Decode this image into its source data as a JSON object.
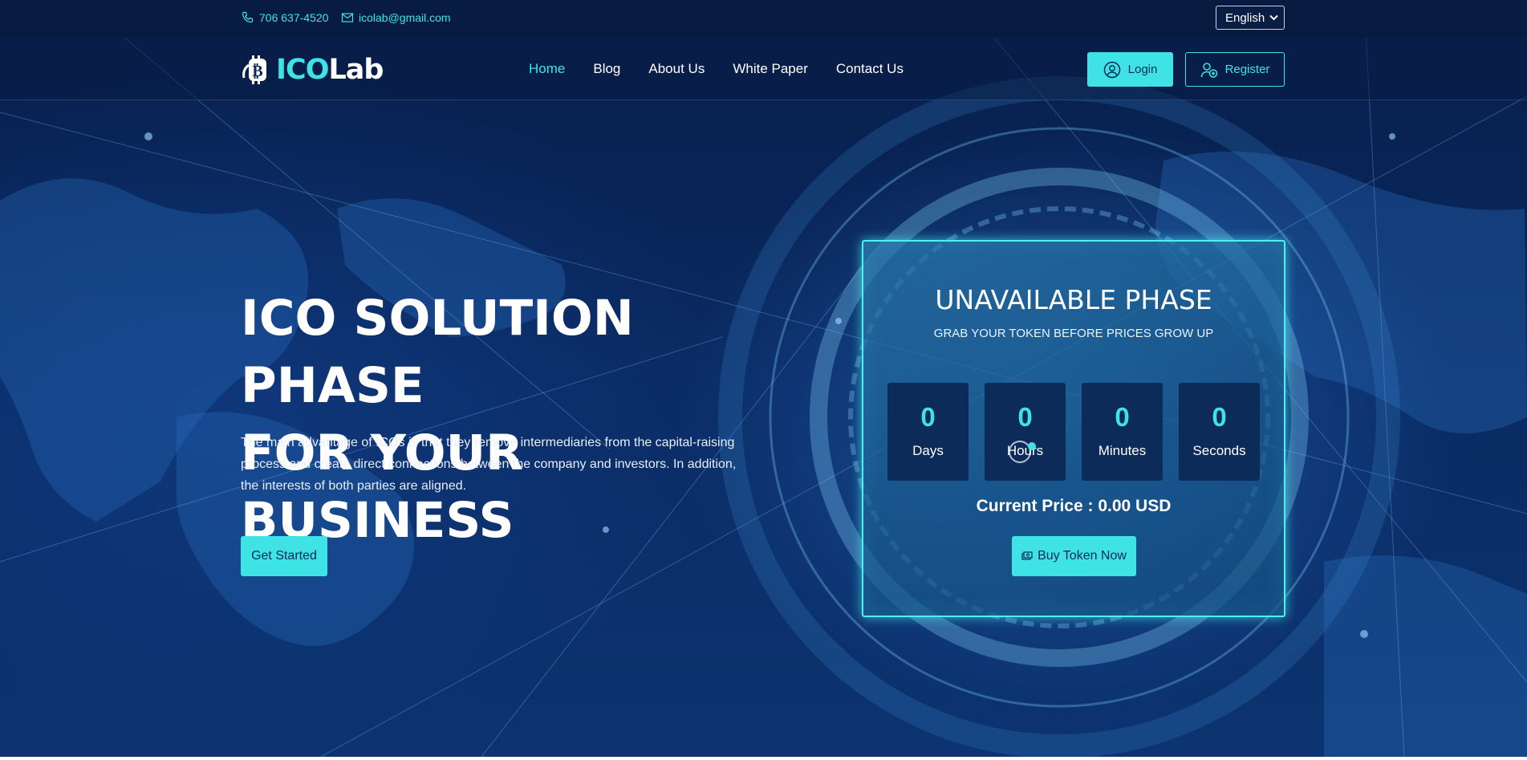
{
  "topbar": {
    "phone": "706 637-4520",
    "email": "icolab@gmail.com",
    "language": "English"
  },
  "header": {
    "logo_text": "ICOLab",
    "nav": [
      "Home",
      "Blog",
      "About Us",
      "White Paper",
      "Contact Us"
    ],
    "active_nav": "Home",
    "login_label": "Login",
    "register_label": "Register"
  },
  "hero": {
    "title_line1": "ICO SOLUTION PHASE",
    "title_line2": "FOR YOUR BUSINESS",
    "description": "The main advantage of ICOs is that they remove intermediaries from the capital-raising process and create direct connections between the company and investors. In addition, the interests of both parties are aligned.",
    "cta_label": "Get Started"
  },
  "countdown": {
    "title": "UNAVAILABLE PHASE",
    "subtitle": "GRAB YOUR TOKEN BEFORE PRICES GROW UP",
    "units": [
      {
        "value": "0",
        "label": "Days"
      },
      {
        "value": "0",
        "label": "Hours"
      },
      {
        "value": "0",
        "label": "Minutes"
      },
      {
        "value": "0",
        "label": "Seconds"
      }
    ],
    "price_text": "Current Price : 0.00 USD",
    "buy_label": "Buy Token Now"
  },
  "colors": {
    "accent": "#3fe3e6",
    "background": "#0a2a62",
    "topbar": "#081b40"
  },
  "icons": {
    "phone": "phone-icon",
    "email": "mail-icon",
    "login": "user-circle-icon",
    "register": "user-plus-icon",
    "buy": "money-icon"
  }
}
